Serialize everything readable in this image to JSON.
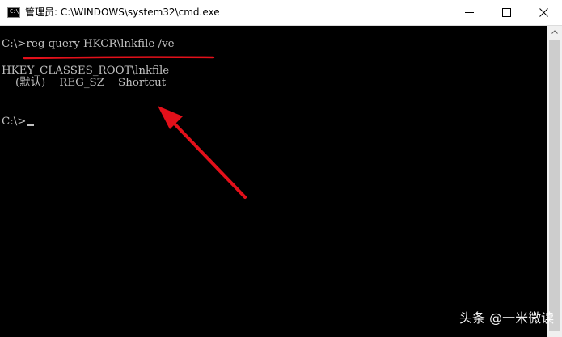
{
  "window": {
    "title": "管理员: C:\\WINDOWS\\system32\\cmd.exe",
    "app_icon_label": "C:\\",
    "min_icon": "minimize-icon",
    "max_icon": "maximize-icon",
    "close_icon": "close-icon"
  },
  "console": {
    "lines": [
      "C:\\>reg query HKCR\\lnkfile /ve",
      "HKEY_CLASSES_ROOT\\lnkfile",
      "    (默认)    REG_SZ    Shortcut",
      "C:\\>"
    ],
    "text_color": "#c0c0c0",
    "background": "#000000"
  },
  "annotation": {
    "color": "#e3101a",
    "underline_target": "command",
    "arrow_target": "Shortcut"
  },
  "watermark": {
    "text": "头条 @一米微读"
  }
}
